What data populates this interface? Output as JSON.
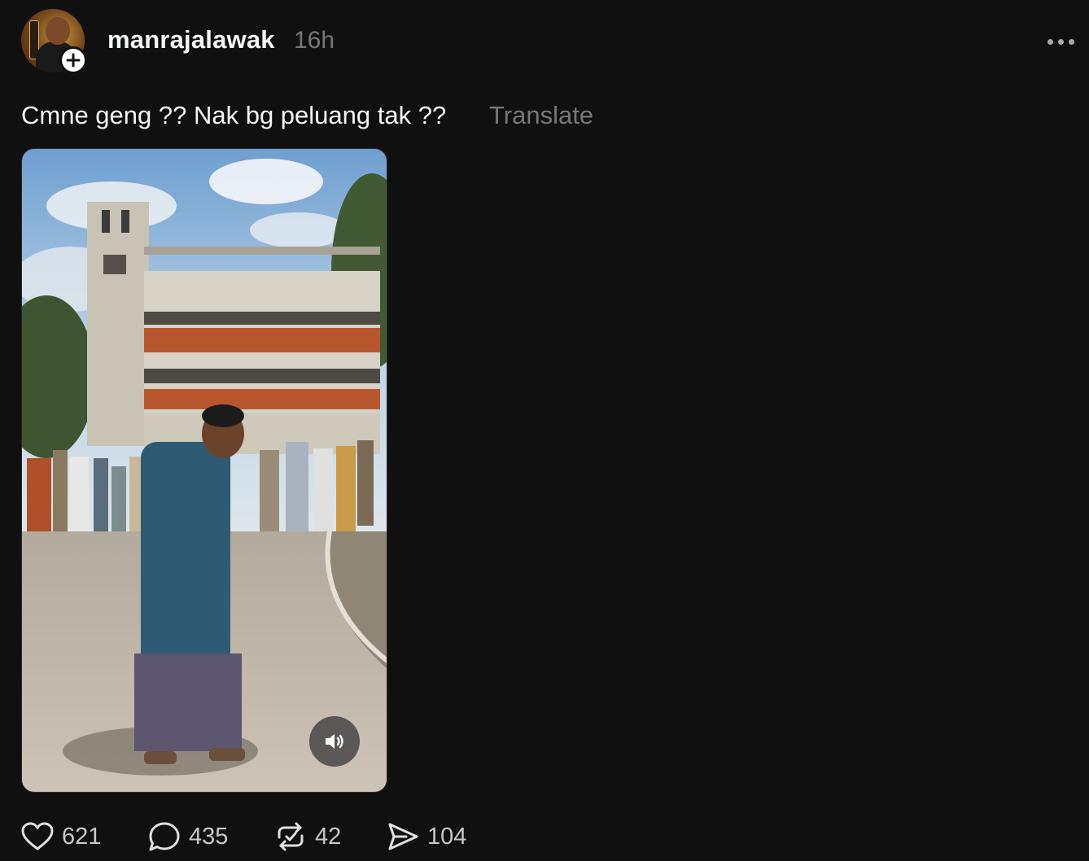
{
  "post": {
    "username": "manrajalawak",
    "timestamp": "16h",
    "caption": "Cmne geng ?? Nak bg peluang tak ??",
    "translate_label": "Translate"
  },
  "media": {
    "type": "video",
    "sound_icon": "speaker-icon"
  },
  "actions": {
    "likes": "621",
    "replies": "435",
    "reposts": "42",
    "shares": "104"
  },
  "icons": {
    "like": "heart-icon",
    "reply": "speech-bubble-icon",
    "repost": "repost-icon",
    "share": "paper-plane-icon",
    "more": "ellipsis-icon",
    "follow": "plus-icon"
  },
  "colors": {
    "background": "#101010",
    "primary_text": "#f3f5f7",
    "secondary_text": "#777777"
  }
}
